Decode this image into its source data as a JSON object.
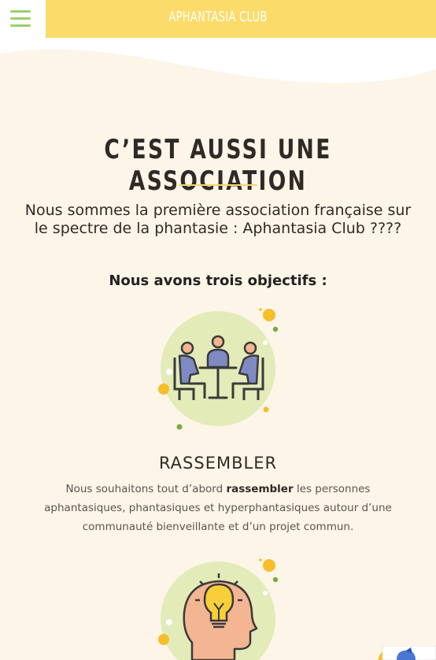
{
  "header": {
    "brand": "APHANTASIA CLUB"
  },
  "section": {
    "title": "C’EST AUSSI UNE ASSOCIATION",
    "intro": "Nous sommes la première association française sur le spectre de la phantasie : Aphantasia Club ????",
    "objectives_heading": "Nous avons trois objectifs :"
  },
  "items": [
    {
      "title": "RASSEMBLER",
      "text_before": "Nous souhaitons tout d’abord ",
      "text_bold": "rassembler",
      "text_after": " les personnes aphantasiques, phantasiques et hyperphantasiques autour d’une communauté bienveillante et d’un projet commun.",
      "icon": "meeting-icon"
    },
    {
      "icon": "idea-head-icon"
    }
  ],
  "colors": {
    "header": "#fbdc6a",
    "menu_icon": "#9ccf6a",
    "background": "#fdf5e8",
    "illustration_circle": "#e3ebb8",
    "accent_dot": "#f7be2b",
    "green_dot": "#7aaa3f"
  }
}
